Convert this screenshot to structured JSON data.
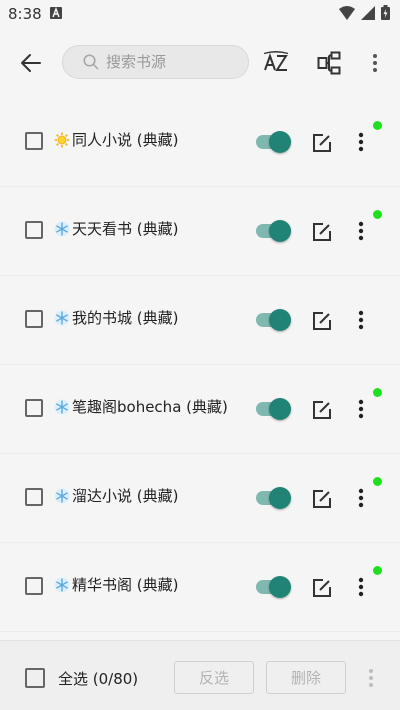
{
  "status_bar": {
    "time": "8:38"
  },
  "search": {
    "placeholder": "搜索书源"
  },
  "sources": [
    {
      "name": "同人小说 (典藏)",
      "icon": "sun-icon",
      "enabled": true,
      "has_update_dot": true
    },
    {
      "name": "天天看书 (典藏)",
      "icon": "snowflake-icon",
      "enabled": true,
      "has_update_dot": true
    },
    {
      "name": "我的书城 (典藏)",
      "icon": "snowflake-icon",
      "enabled": true,
      "has_update_dot": false
    },
    {
      "name": "笔趣阁bohecha (典藏)",
      "icon": "snowflake-icon",
      "enabled": true,
      "has_update_dot": true
    },
    {
      "name": "溜达小说 (典藏)",
      "icon": "snowflake-icon",
      "enabled": true,
      "has_update_dot": true
    },
    {
      "name": "精华书阁 (典藏)",
      "icon": "snowflake-icon",
      "enabled": true,
      "has_update_dot": true
    }
  ],
  "bottom_bar": {
    "select_all_label": "全选 (0/80)",
    "invert_label": "反选",
    "delete_label": "删除"
  },
  "colors": {
    "accent": "#218276",
    "track": "#7fb8b1",
    "dot": "#1fe01f"
  }
}
